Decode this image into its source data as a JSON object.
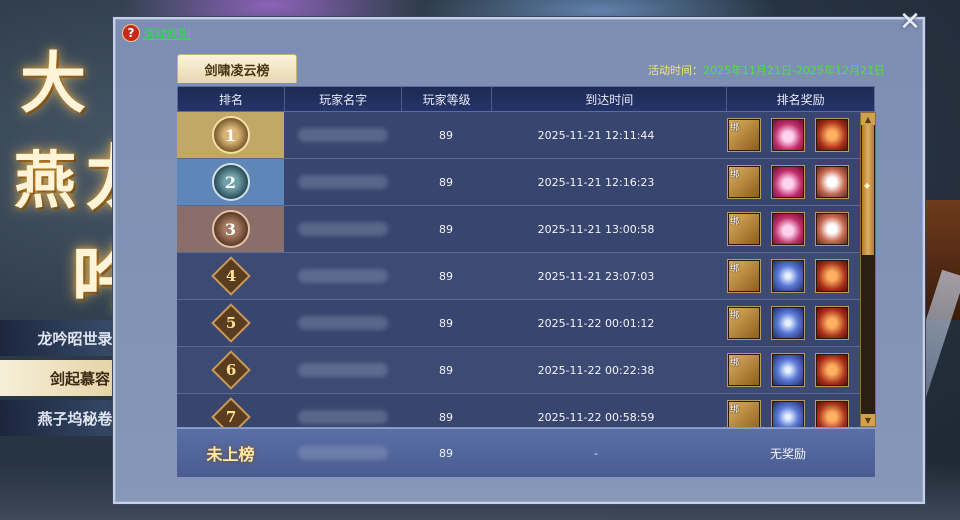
{
  "panel_title": {
    "chars": [
      "大",
      "燕",
      "龙",
      "吟"
    ]
  },
  "side_nav": [
    {
      "label": "龙吟昭世录",
      "active": false
    },
    {
      "label": "剑起慕容",
      "active": true
    },
    {
      "label": "燕子坞秘卷",
      "active": false
    }
  ],
  "rules_link": {
    "icon": "?",
    "label": "活动规则"
  },
  "tab_label": "剑啸凌云榜",
  "activity_time": {
    "label": "活动时间：",
    "value": "2025年11月21日-2025年12月21日"
  },
  "table": {
    "headers": [
      "排名",
      "玩家名字",
      "玩家等级",
      "到达时间",
      "排名奖励"
    ],
    "rows": [
      {
        "rank": "1",
        "level": "89",
        "time": "2025-11-21  12:11:44",
        "rewards": [
          "book-icon",
          "pink-gem-icon",
          "crest-icon"
        ]
      },
      {
        "rank": "2",
        "level": "89",
        "time": "2025-11-21  12:16:23",
        "rewards": [
          "book-icon",
          "pink-gem-icon",
          "white-pet-icon"
        ]
      },
      {
        "rank": "3",
        "level": "89",
        "time": "2025-11-21  13:00:58",
        "rewards": [
          "book-icon",
          "pink-gem-icon",
          "white-pet-icon"
        ]
      },
      {
        "rank": "4",
        "level": "89",
        "time": "2025-11-21  23:07:03",
        "rewards": [
          "book-icon",
          "blue-crystal-icon",
          "crest-icon"
        ]
      },
      {
        "rank": "5",
        "level": "89",
        "time": "2025-11-22  00:01:12",
        "rewards": [
          "book-icon",
          "blue-crystal-icon",
          "crest-icon"
        ]
      },
      {
        "rank": "6",
        "level": "89",
        "time": "2025-11-22  00:22:38",
        "rewards": [
          "book-icon",
          "blue-crystal-icon",
          "crest-icon"
        ]
      },
      {
        "rank": "7",
        "level": "89",
        "time": "2025-11-22  00:58:59",
        "rewards": [
          "book-icon",
          "blue-crystal-icon",
          "crest-icon"
        ]
      }
    ]
  },
  "my_rank": {
    "rank": "未上榜",
    "level": "89",
    "time": "-",
    "reward": "无奖励"
  },
  "icons": {
    "close": "✕",
    "scroll_up": "▲",
    "scroll_down": "▼"
  }
}
